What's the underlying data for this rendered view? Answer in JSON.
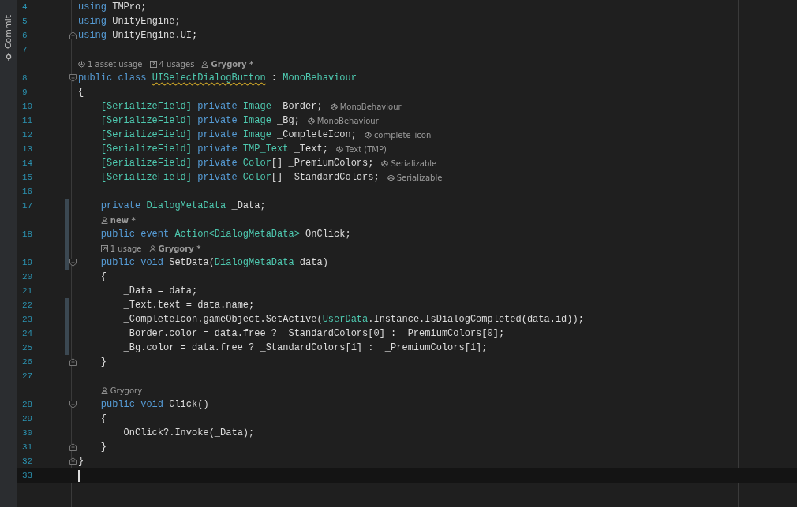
{
  "sidebar": {
    "tab": "Commit"
  },
  "lines": [
    {
      "kind": "code",
      "number": "4",
      "tokens": [
        {
          "kind": "keyword",
          "s": "using"
        },
        {
          "kind": "plain",
          "s": " TMPro;"
        }
      ]
    },
    {
      "kind": "code",
      "number": "5",
      "tokens": [
        {
          "kind": "keyword",
          "s": "using"
        },
        {
          "kind": "plain",
          "s": " UnityEngine;"
        }
      ]
    },
    {
      "kind": "code",
      "number": "6",
      "fold_end": true,
      "tokens": [
        {
          "kind": "keyword",
          "s": "using"
        },
        {
          "kind": "plain",
          "s": " UnityEngine.UI;"
        }
      ]
    },
    {
      "kind": "code",
      "number": "7"
    },
    {
      "kind": "hint",
      "items": [
        {
          "kind": "asset",
          "text": "1 asset usage",
          "bold": false
        },
        {
          "kind": "usages",
          "text": "4 usages",
          "bold": false
        },
        {
          "kind": "author",
          "text": "Grygory *",
          "bold": true
        }
      ]
    },
    {
      "kind": "code",
      "number": "8",
      "fold_start": true,
      "tokens": [
        {
          "kind": "keyword",
          "s": "public class "
        },
        {
          "kind": "warning",
          "s": "UISelectDialogButton"
        },
        {
          "kind": "plain",
          "s": " : "
        },
        {
          "kind": "type",
          "s": "MonoBehaviour"
        }
      ]
    },
    {
      "kind": "code",
      "number": "9",
      "tokens": [
        {
          "kind": "plain",
          "s": "{"
        }
      ]
    },
    {
      "kind": "block",
      "children": [
        {
          "kind": "code",
          "number": "10",
          "tokens": [
            {
              "kind": "type",
              "s": "[SerializeField]"
            },
            {
              "kind": "keyword",
              "s": " private "
            },
            {
              "kind": "type",
              "s": "Image"
            },
            {
              "kind": "plain",
              "s": " _Border;"
            }
          ],
          "inlay": "MonoBehaviour"
        },
        {
          "kind": "code",
          "number": "11",
          "tokens": [
            {
              "kind": "type",
              "s": "[SerializeField]"
            },
            {
              "kind": "keyword",
              "s": " private "
            },
            {
              "kind": "type",
              "s": "Image"
            },
            {
              "kind": "plain",
              "s": " _Bg;"
            }
          ],
          "inlay": "MonoBehaviour"
        },
        {
          "kind": "code",
          "number": "12",
          "tokens": [
            {
              "kind": "type",
              "s": "[SerializeField]"
            },
            {
              "kind": "keyword",
              "s": " private "
            },
            {
              "kind": "type",
              "s": "Image"
            },
            {
              "kind": "plain",
              "s": " _CompleteIcon;"
            }
          ],
          "inlay": "complete_icon"
        },
        {
          "kind": "code",
          "number": "13",
          "tokens": [
            {
              "kind": "type",
              "s": "[SerializeField]"
            },
            {
              "kind": "keyword",
              "s": " private "
            },
            {
              "kind": "type",
              "s": "TMP_Text"
            },
            {
              "kind": "plain",
              "s": " _Text;"
            }
          ],
          "inlay": "Text (TMP)"
        },
        {
          "kind": "code",
          "number": "14",
          "tokens": [
            {
              "kind": "type",
              "s": "[SerializeField]"
            },
            {
              "kind": "keyword",
              "s": " private "
            },
            {
              "kind": "type",
              "s": "Color"
            },
            {
              "kind": "plain",
              "s": "[] _PremiumColors;"
            }
          ],
          "inlay": "Serializable"
        },
        {
          "kind": "code",
          "number": "15",
          "tokens": [
            {
              "kind": "type",
              "s": "[SerializeField]"
            },
            {
              "kind": "keyword",
              "s": " private "
            },
            {
              "kind": "type",
              "s": "Color"
            },
            {
              "kind": "plain",
              "s": "[] _StandardColors;"
            }
          ],
          "inlay": "Serializable"
        },
        {
          "kind": "code",
          "number": "16"
        },
        {
          "kind": "code",
          "number": "17",
          "changed": true,
          "tokens": [
            {
              "kind": "keyword",
              "s": "private "
            },
            {
              "kind": "type",
              "s": "DialogMetaData"
            },
            {
              "kind": "plain",
              "s": " _Data;"
            }
          ]
        },
        {
          "kind": "hint",
          "changed": true,
          "items": [
            {
              "kind": "author",
              "text": "new *",
              "bold": true
            }
          ]
        },
        {
          "kind": "code",
          "number": "18",
          "changed": true,
          "tokens": [
            {
              "kind": "keyword",
              "s": "public event "
            },
            {
              "kind": "type",
              "s": "Action<DialogMetaData>"
            },
            {
              "kind": "plain",
              "s": " OnClick;"
            }
          ]
        },
        {
          "kind": "hint",
          "changed": true,
          "items": [
            {
              "kind": "usages",
              "text": "1 usage",
              "bold": false
            },
            {
              "kind": "author",
              "text": "Grygory *",
              "bold": true
            }
          ]
        },
        {
          "kind": "code",
          "number": "19",
          "changed": true,
          "fold_start": true,
          "tokens": [
            {
              "kind": "keyword",
              "s": "public void "
            },
            {
              "kind": "plain",
              "s": "SetData("
            },
            {
              "kind": "type",
              "s": "DialogMetaData"
            },
            {
              "kind": "plain",
              "s": " data)"
            }
          ]
        },
        {
          "kind": "code",
          "number": "20",
          "tokens": [
            {
              "kind": "plain",
              "s": "{"
            }
          ]
        },
        {
          "kind": "block",
          "children": [
            {
              "kind": "code",
              "number": "21",
              "tokens": [
                {
                  "kind": "plain",
                  "s": "_Data = data;"
                }
              ]
            },
            {
              "kind": "code",
              "number": "22",
              "changed": true,
              "tokens": [
                {
                  "kind": "plain",
                  "s": "_Text.text = data.name;"
                }
              ]
            },
            {
              "kind": "code",
              "number": "23",
              "changed": true,
              "tokens": [
                {
                  "kind": "plain",
                  "s": "_CompleteIcon.gameObject.SetActive("
                },
                {
                  "kind": "type",
                  "s": "UserData"
                },
                {
                  "kind": "plain",
                  "s": ".Instance.IsDialogCompleted(data.id));"
                }
              ]
            },
            {
              "kind": "code",
              "number": "24",
              "changed": true,
              "tokens": [
                {
                  "kind": "plain",
                  "s": "_Border.color = data.free ? _StandardColors[0] : _PremiumColors[0];"
                }
              ]
            },
            {
              "kind": "code",
              "number": "25",
              "changed": true,
              "tokens": [
                {
                  "kind": "plain",
                  "s": "_Bg.color = data.free ? _StandardColors[1] :  _PremiumColors[1];"
                }
              ]
            }
          ]
        },
        {
          "kind": "code",
          "number": "26",
          "fold_end": true,
          "tokens": [
            {
              "kind": "plain",
              "s": "}"
            }
          ]
        },
        {
          "kind": "code",
          "number": "27"
        },
        {
          "kind": "hint",
          "items": [
            {
              "kind": "author",
              "text": "Grygory",
              "bold": false
            }
          ]
        },
        {
          "kind": "code",
          "number": "28",
          "fold_start": true,
          "tokens": [
            {
              "kind": "keyword",
              "s": "public void "
            },
            {
              "kind": "plain",
              "s": "Click()"
            }
          ]
        },
        {
          "kind": "code",
          "number": "29",
          "tokens": [
            {
              "kind": "plain",
              "s": "{"
            }
          ]
        },
        {
          "kind": "block",
          "children": [
            {
              "kind": "code",
              "number": "30",
              "tokens": [
                {
                  "kind": "plain",
                  "s": "OnClick?.Invoke(_Data);"
                }
              ]
            }
          ]
        },
        {
          "kind": "code",
          "number": "31",
          "fold_end": true,
          "tokens": [
            {
              "kind": "plain",
              "s": "}"
            }
          ]
        }
      ]
    },
    {
      "kind": "code",
      "number": "32",
      "fold_end": true,
      "tokens": [
        {
          "kind": "plain",
          "s": "}"
        }
      ]
    },
    {
      "kind": "code",
      "number": "33",
      "current": true
    }
  ]
}
